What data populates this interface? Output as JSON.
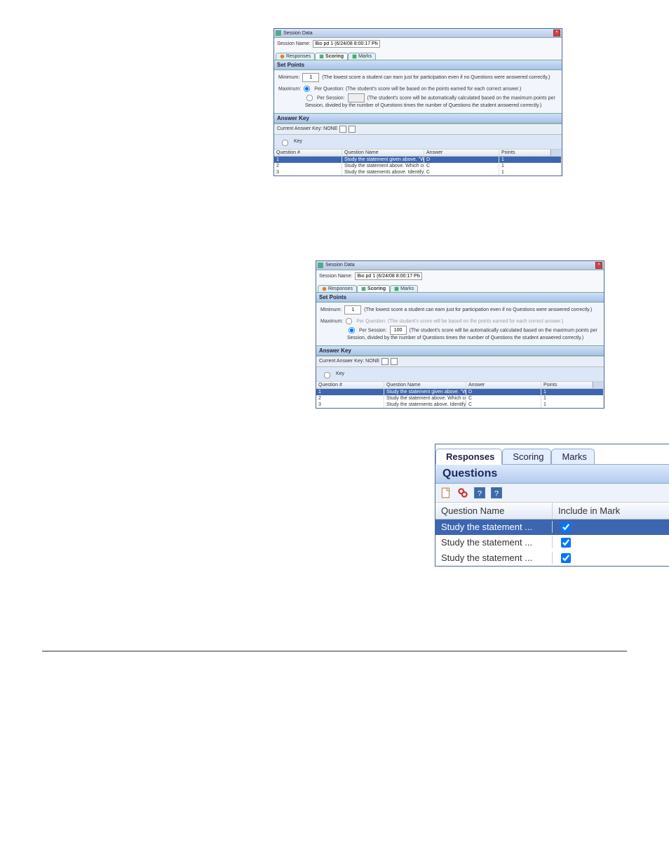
{
  "dialog": {
    "title": "Session Data",
    "session_name_label": "Session Name:",
    "session_name_value": "Bio pd 1 (6/24/08 8:00:17 PM)"
  },
  "tabs": {
    "responses": "Responses",
    "scoring": "Scoring",
    "marks": "Marks"
  },
  "set_points": {
    "header": "Set Points",
    "minimum_label": "Minimum:",
    "minimum_value": "1",
    "minimum_note": "(The lowest score a student can earn just for participation even if no Questions were answered correctly.)",
    "maximum_label": "Maximum:",
    "per_question_label": "Per Question:",
    "per_question_note": "(The student's score will be based on the points earned for each correct answer.)",
    "per_session_label": "Per Session:",
    "per_session_value_s1": "",
    "per_session_value_s2": "100",
    "per_session_note": "(The student's score will be automatically calculated based on the maximum points per Session, divided by the number of Questions times the number of Questions the student answered correctly.)"
  },
  "answer_key": {
    "header": "Answer Key",
    "current_label": "Current Answer Key: NONE",
    "key_label": "Key",
    "cols": {
      "qnum": "Question #",
      "qname": "Question Name",
      "answer": "Answer",
      "points": "Points"
    },
    "rows": [
      {
        "num": "1",
        "name": "Study the statement given above. \"When s...",
        "answer": "D",
        "points": "1"
      },
      {
        "num": "2",
        "name": "Study the statement above. Which cell or...",
        "answer": "C",
        "points": "1"
      },
      {
        "num": "3",
        "name": "Study the statements above. Identify the ...",
        "answer": "C",
        "points": "1"
      }
    ]
  },
  "s3": {
    "questions_header": "Questions",
    "cols": {
      "name": "Question Name",
      "include": "Include in Mark"
    },
    "rows": [
      {
        "name": "Study the statement ...",
        "checked": true,
        "sel": true
      },
      {
        "name": "Study the statement ...",
        "checked": true,
        "sel": false
      },
      {
        "name": "Study the statement ...",
        "checked": true,
        "sel": false
      }
    ]
  }
}
